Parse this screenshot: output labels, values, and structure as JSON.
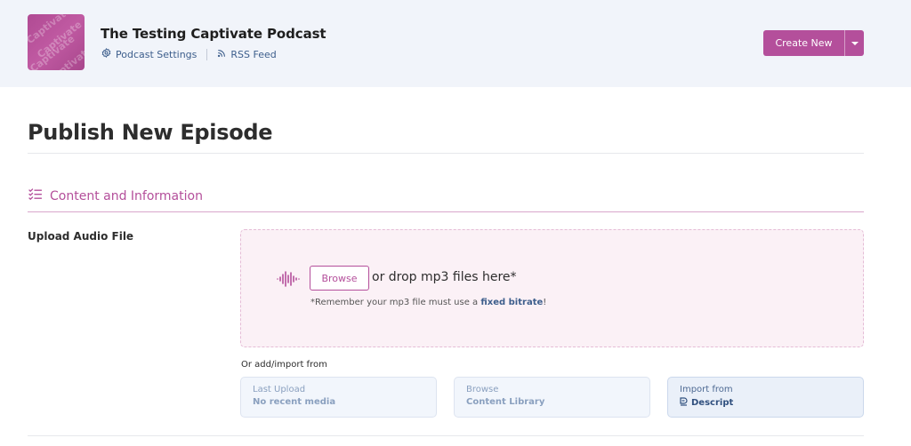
{
  "header": {
    "podcast_title": "The Testing Captivate Podcast",
    "artwork_watermark": "Captivate",
    "links": [
      {
        "label": "Podcast Settings",
        "icon": "gear-icon"
      },
      {
        "label": "RSS Feed",
        "icon": "rss-icon"
      }
    ],
    "create_button": {
      "label": "Create New",
      "icon": "chevron-down-icon"
    }
  },
  "main": {
    "page_title": "Publish New Episode",
    "section_title": "Content and Information",
    "section_icon": "checklist-icon",
    "upload": {
      "label": "Upload Audio File",
      "browse_label": "Browse",
      "drop_text": "or drop mp3 files here*",
      "note_prefix": "*Remember your mp3 file must use a ",
      "note_link": "fixed bitrate",
      "note_suffix": "!",
      "icon": "waveform-icon"
    },
    "import": {
      "label": "Or add/import from",
      "cards": [
        {
          "line1": "Last Upload",
          "line2": "No recent media"
        },
        {
          "line1": "Browse",
          "line2": "Content Library"
        },
        {
          "line1": "Import from",
          "line2": "Descript",
          "icon": "descript-icon"
        }
      ]
    }
  },
  "colors": {
    "accent": "#b44f9b",
    "header_bg": "#f1f4fa",
    "link": "#3d5e8c",
    "dropzone_bg": "#fbf1f6"
  }
}
